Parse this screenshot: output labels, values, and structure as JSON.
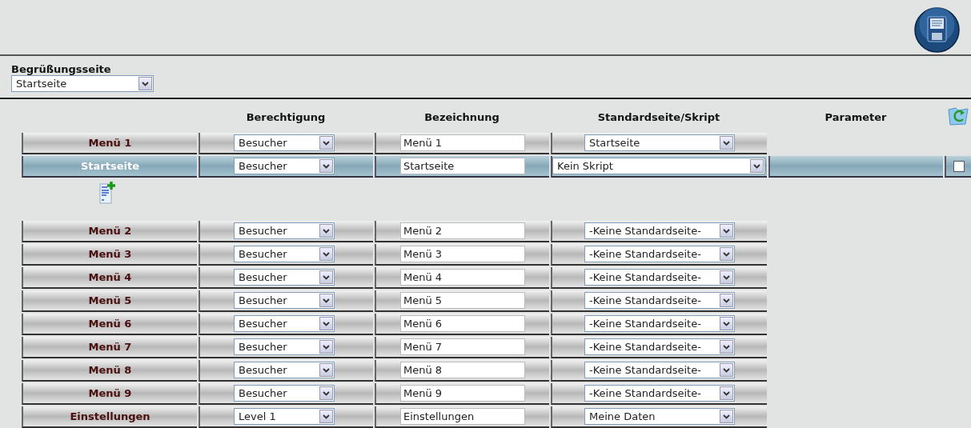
{
  "welcome": {
    "label": "Begrüßungsseite",
    "value": "Startseite"
  },
  "columns": [
    "Berechtigung",
    "Bezeichnung",
    "Standardseite/Skript",
    "Parameter"
  ],
  "rows": [
    {
      "kind": "menu",
      "selected": false,
      "title": "Menü 1",
      "permission": "Besucher",
      "name": "Menü 1",
      "page": "Startseite"
    },
    {
      "kind": "page",
      "selected": true,
      "title": "Startseite",
      "permission": "Besucher",
      "name": "Startseite",
      "page": "Kein Skript",
      "checked": false
    },
    {
      "kind": "add"
    },
    {
      "kind": "menu",
      "selected": false,
      "title": "Menü 2",
      "permission": "Besucher",
      "name": "Menü 2",
      "page": "-Keine Standardseite-"
    },
    {
      "kind": "menu",
      "selected": false,
      "title": "Menü 3",
      "permission": "Besucher",
      "name": "Menü 3",
      "page": "-Keine Standardseite-"
    },
    {
      "kind": "menu",
      "selected": false,
      "title": "Menü 4",
      "permission": "Besucher",
      "name": "Menü 4",
      "page": "-Keine Standardseite-"
    },
    {
      "kind": "menu",
      "selected": false,
      "title": "Menü 5",
      "permission": "Besucher",
      "name": "Menü 5",
      "page": "-Keine Standardseite-"
    },
    {
      "kind": "menu",
      "selected": false,
      "title": "Menü 6",
      "permission": "Besucher",
      "name": "Menü 6",
      "page": "-Keine Standardseite-"
    },
    {
      "kind": "menu",
      "selected": false,
      "title": "Menü 7",
      "permission": "Besucher",
      "name": "Menü 7",
      "page": "-Keine Standardseite-"
    },
    {
      "kind": "menu",
      "selected": false,
      "title": "Menü 8",
      "permission": "Besucher",
      "name": "Menü 8",
      "page": "-Keine Standardseite-"
    },
    {
      "kind": "menu",
      "selected": false,
      "title": "Menü 9",
      "permission": "Besucher",
      "name": "Menü 9",
      "page": "-Keine Standardseite-"
    },
    {
      "kind": "menu",
      "selected": false,
      "title": "Einstellungen",
      "permission": "Level 1",
      "name": "Einstellungen",
      "page": "Meine Daten"
    }
  ]
}
